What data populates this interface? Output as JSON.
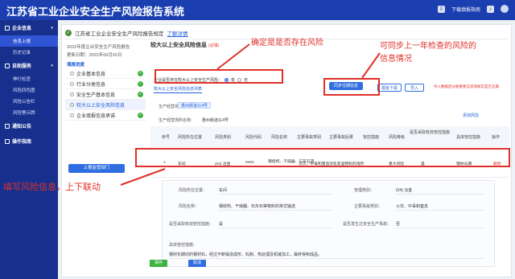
{
  "app": {
    "title": "江苏省工业企业安全生产风险报告系统",
    "header_link": "下载填报指南"
  },
  "sidebar": {
    "groups": [
      {
        "label": "企业信息",
        "items": [
          {
            "label": "信息上报",
            "active": true
          },
          {
            "label": "历史记录",
            "active": false
          }
        ]
      },
      {
        "label": "自助服务",
        "items": [
          {
            "label": "伸行检查",
            "active": false
          },
          {
            "label": "风险四色图",
            "active": false
          },
          {
            "label": "风险公告栏",
            "active": false
          },
          {
            "label": "风险警示牌",
            "active": false
          }
        ]
      },
      {
        "label": "通知公告",
        "items": []
      },
      {
        "label": "操作指南",
        "items": []
      }
    ]
  },
  "banner": {
    "text": "江苏省工业企业安全生产风险报告规定",
    "link": "了解详情"
  },
  "left_panel": {
    "line1": "2022年度企业安全生产风险报告",
    "line2": "更新日期：2022年06月02日",
    "progress_title": "填报进度",
    "steps": [
      {
        "label": "企业基本信息",
        "done": true,
        "active": false
      },
      {
        "label": "行业分类信息",
        "done": true,
        "active": false
      },
      {
        "label": "安全生产基本信息",
        "done": true,
        "active": false
      },
      {
        "label": "较大以上安全风险信息",
        "done": false,
        "active": true
      },
      {
        "label": "企业填报信息承诺",
        "done": true,
        "active": false
      }
    ],
    "submit_label": "上报监管部门"
  },
  "section": {
    "title": "较大以上安全风险信息",
    "required": "(必填)"
  },
  "risk_question": {
    "label": "企业是否存在较大以上安全生产风险：",
    "yes": "有",
    "no": "无"
  },
  "tab": "较大以上安全风险信息列表",
  "buttons": {
    "sync": "同步往期信息",
    "template": "模板下载",
    "import": "导入",
    "import_hint": "导入数据后分册重要信息请核实是否正确"
  },
  "fields": {
    "regulator_label": "生产经营场所:",
    "regulator_pill": "惠州街道114号",
    "site_label": "生产经营场所名称:",
    "site_value": "惠州街道114号",
    "add": "添加风险"
  },
  "table": {
    "headers": [
      "序号",
      "风险所在位置",
      "风险类别",
      "风险代码",
      "风险名称",
      "主要事故类别",
      "主要事故后果",
      "管控措施",
      "风险等级",
      "是否采取有效管控措施",
      "具体管控措施",
      "操作"
    ],
    "row": {
      "no": "1",
      "location": "车间",
      "category": "(04) 冶金",
      "code": "0402",
      "name": "钢结构、干燥器、石灰石等",
      "accident": "火灾、中毒和窒息",
      "consequence": "涉及高温物料的场所",
      "control": "",
      "level": "重大风险",
      "effective": "是",
      "measure": "钢材长期",
      "op": "删除"
    }
  },
  "detail": {
    "loc_label": "风险所在位置：",
    "loc_value": "车间",
    "cat_label": "管理类别：",
    "cat_value": "(04) 冶金",
    "name_label": "风险名称：",
    "name_value": "钢结构、干燥器、石灰石等物料的常式输送",
    "acc_label": "主要事故类别：",
    "acc_value": "火灾、中毒和窒息",
    "eff_label": "是否采取有效管控措施：",
    "eff_value": "是",
    "high_label": "是否发生过安全生产事故：",
    "high_value": "否",
    "meas_label": "具体管控措施：",
    "meas_value": "钢材长期切的钢材石，经过不断锻造成形、轧制、热处理及机械加工，最终得到成品。"
  },
  "actions": {
    "save": "保存",
    "cancel": "取消"
  },
  "annotations": {
    "a1": "确定是是否存在风险",
    "a2": "可同步上一年检查的风险的",
    "a3": "信息情况",
    "a4": "填写风险信息，上下联动"
  }
}
